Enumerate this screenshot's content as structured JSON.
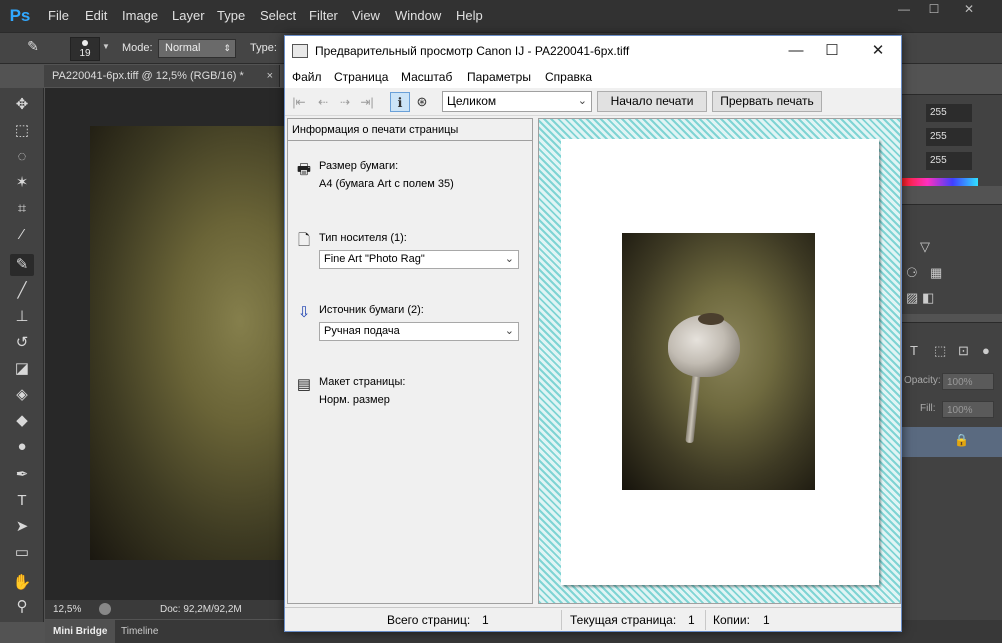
{
  "photoshop": {
    "logo": "Ps",
    "menu": [
      "File",
      "Edit",
      "Image",
      "Layer",
      "Type",
      "Select",
      "Filter",
      "View",
      "Window",
      "Help"
    ],
    "options": {
      "brush_size": "19",
      "mode_label": "Mode:",
      "mode_value": "Normal",
      "type_label": "Type:"
    },
    "document_tab": "PA220041-6px.tiff @ 12,5% (RGB/16) *",
    "status": {
      "zoom": "12,5%",
      "doc_info": "Doc: 92,2M/92,2M"
    },
    "bottom_tabs": [
      "Mini Bridge",
      "Timeline"
    ],
    "color_values": [
      "255",
      "255",
      "255"
    ],
    "layers": {
      "opacity_label": "Opacity:",
      "opacity_value": "100%",
      "fill_label": "Fill:",
      "fill_value": "100%"
    },
    "colors": {
      "accent": "#31a8ff",
      "panel": "#424242",
      "background": "#535353"
    }
  },
  "dialog": {
    "title": "Предварительный просмотр Canon IJ - PA220041-6px.tiff",
    "menu": [
      "Файл",
      "Страница",
      "Масштаб",
      "Параметры",
      "Справка"
    ],
    "zoom_select": "Целиком",
    "start_print_button": "Начало печати",
    "cancel_print_button": "Прервать печать",
    "info_panel": {
      "header": "Информация о печати страницы",
      "paper_size_label": "Размер бумаги:",
      "paper_size_value": "A4 (бумага Art с полем 35)",
      "media_type_label": "Тип носителя (1):",
      "media_type_value": "Fine Art \"Photo Rag\"",
      "paper_source_label": "Источник бумаги (2):",
      "paper_source_value": "Ручная подача",
      "page_layout_label": "Макет страницы:",
      "page_layout_value": "Норм. размер"
    },
    "status": {
      "total_pages_label": "Всего страниц:",
      "total_pages_value": "1",
      "current_page_label": "Текущая страница:",
      "current_page_value": "1",
      "copies_label": "Копии:",
      "copies_value": "1"
    }
  }
}
